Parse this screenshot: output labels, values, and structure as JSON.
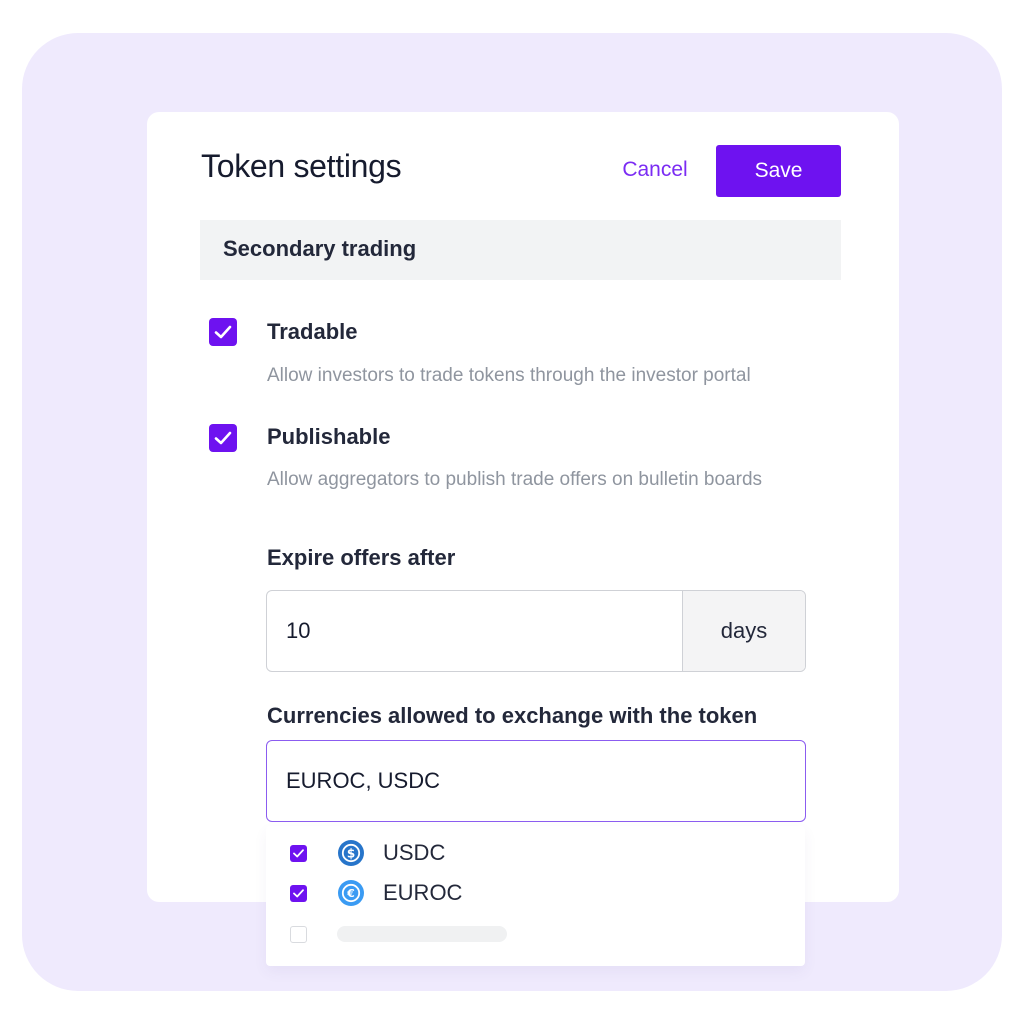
{
  "header": {
    "title": "Token settings",
    "cancel_label": "Cancel",
    "save_label": "Save"
  },
  "section": {
    "title": "Secondary trading"
  },
  "options": [
    {
      "title": "Tradable",
      "description": "Allow investors to trade tokens through the investor portal",
      "checked": true
    },
    {
      "title": "Publishable",
      "description": "Allow aggregators to publish trade offers on bulletin boards",
      "checked": true
    }
  ],
  "expire": {
    "label": "Expire offers after",
    "value": "10",
    "unit": "days"
  },
  "currencies": {
    "label": "Currencies allowed to exchange with the token",
    "value": "EUROC, USDC",
    "items": [
      {
        "label": "USDC",
        "checked": true,
        "icon": "usdc-coin-icon"
      },
      {
        "label": "EUROC",
        "checked": true,
        "icon": "euroc-coin-icon"
      },
      {
        "label": "",
        "checked": false
      }
    ]
  },
  "colors": {
    "accent": "#6e12f0",
    "background": "#efeafd",
    "usdc": "#2775ca",
    "euroc": "#3a9bf3"
  }
}
